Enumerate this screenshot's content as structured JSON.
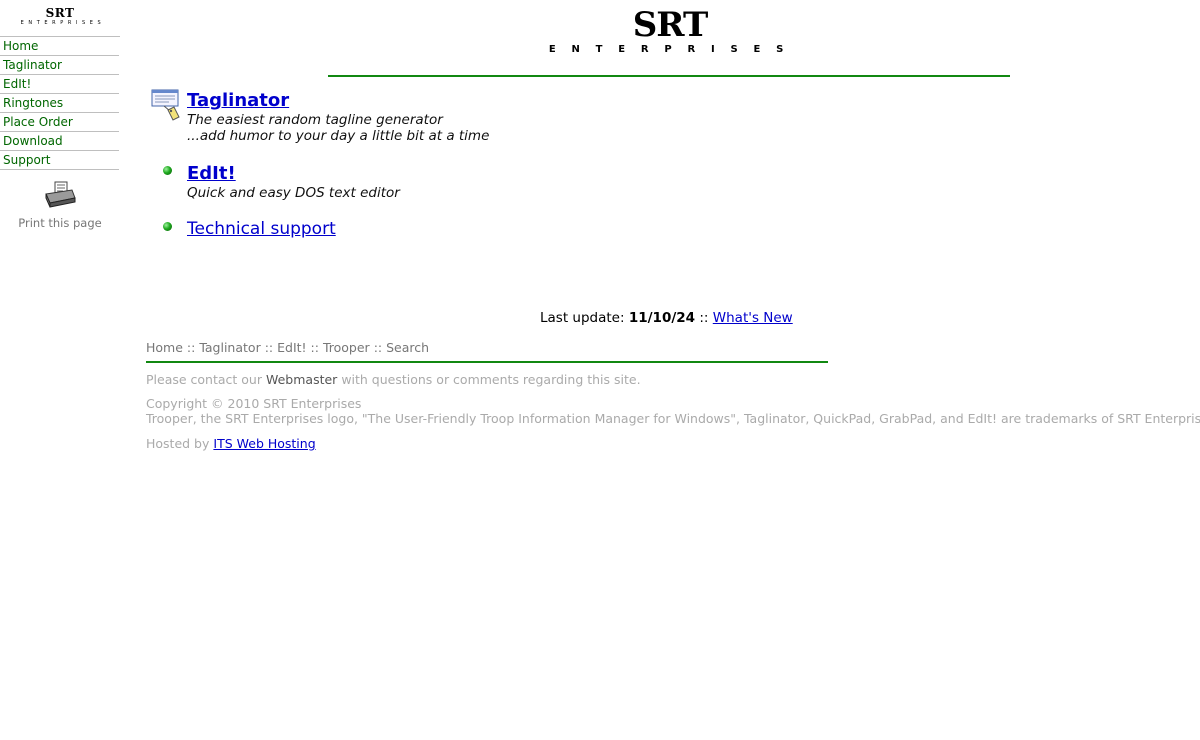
{
  "sidebar": {
    "logo": {
      "title": "SRT",
      "subtitle": "ENTERPRISES"
    },
    "items": [
      {
        "label": "Home"
      },
      {
        "label": "Taglinator"
      },
      {
        "label": "EdIt!"
      },
      {
        "label": "Ringtones"
      },
      {
        "label": "Place Order"
      },
      {
        "label": "Download"
      },
      {
        "label": "Support"
      }
    ],
    "print_label": "Print this page"
  },
  "header": {
    "title": "SRT",
    "subtitle": "ENTERPRISES"
  },
  "products": [
    {
      "name": "Taglinator",
      "desc1": "The easiest random tagline generator",
      "desc2": "...add humor to your day a little bit at a time"
    },
    {
      "name": "EdIt!",
      "desc1": "Quick and easy DOS text editor"
    }
  ],
  "support_link": "Technical support",
  "last_update": {
    "label": "Last update:",
    "date": "11/10/24",
    "sep": "::",
    "whats_new": "What's New"
  },
  "footer_nav": {
    "items": [
      "Home",
      "Taglinator",
      "EdIt!",
      "Trooper",
      "Search"
    ],
    "sep": "::"
  },
  "footer": {
    "contact_pre": "Please contact our",
    "webmaster": "Webmaster",
    "contact_post": "with questions or comments regarding this site.",
    "copyright": "Copyright © 2010 SRT Enterprises",
    "trademarks": "Trooper, the SRT Enterprises logo, \"The User-Friendly Troop Information Manager for Windows\", Taglinator, QuickPad, GrabPad, and EdIt! are trademarks of SRT Enterprises",
    "hosted_by": "Hosted by",
    "host_link": "ITS Web Hosting"
  },
  "colors": {
    "nav": "#006600",
    "rule": "#118811",
    "link": "#0000cc",
    "muted": "#aaaaaa"
  }
}
